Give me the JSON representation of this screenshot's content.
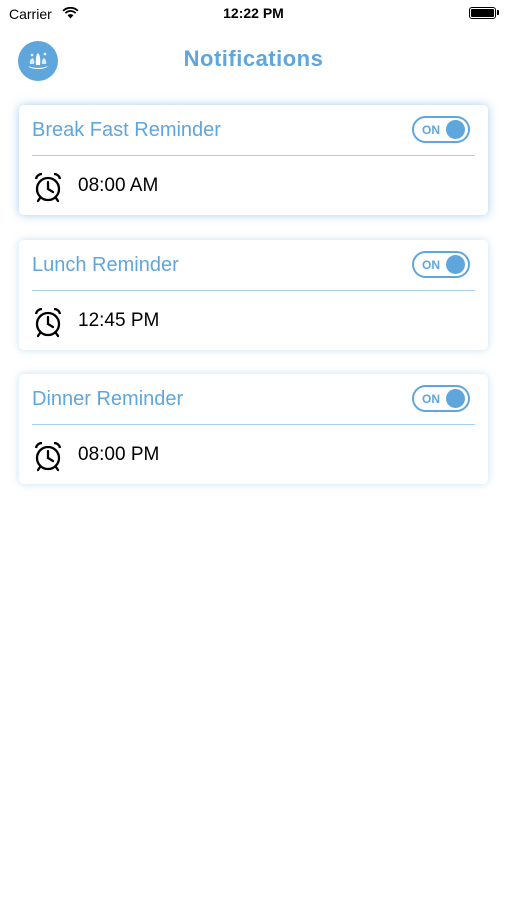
{
  "status_bar": {
    "carrier": "Carrier",
    "time": "12:22 PM"
  },
  "header": {
    "title": "Notifications",
    "logo_icon": "water-splash-icon"
  },
  "colors": {
    "accent": "#5fa6dd",
    "divider": "#a9d0ee",
    "text": "#000000",
    "background": "#ffffff"
  },
  "reminders": [
    {
      "title": "Break Fast Reminder",
      "toggle_label": "ON",
      "enabled": true,
      "time": "08:00 AM"
    },
    {
      "title": "Lunch Reminder",
      "toggle_label": "ON",
      "enabled": true,
      "time": "12:45 PM"
    },
    {
      "title": "Dinner Reminder",
      "toggle_label": "ON",
      "enabled": true,
      "time": "08:00 PM"
    }
  ]
}
